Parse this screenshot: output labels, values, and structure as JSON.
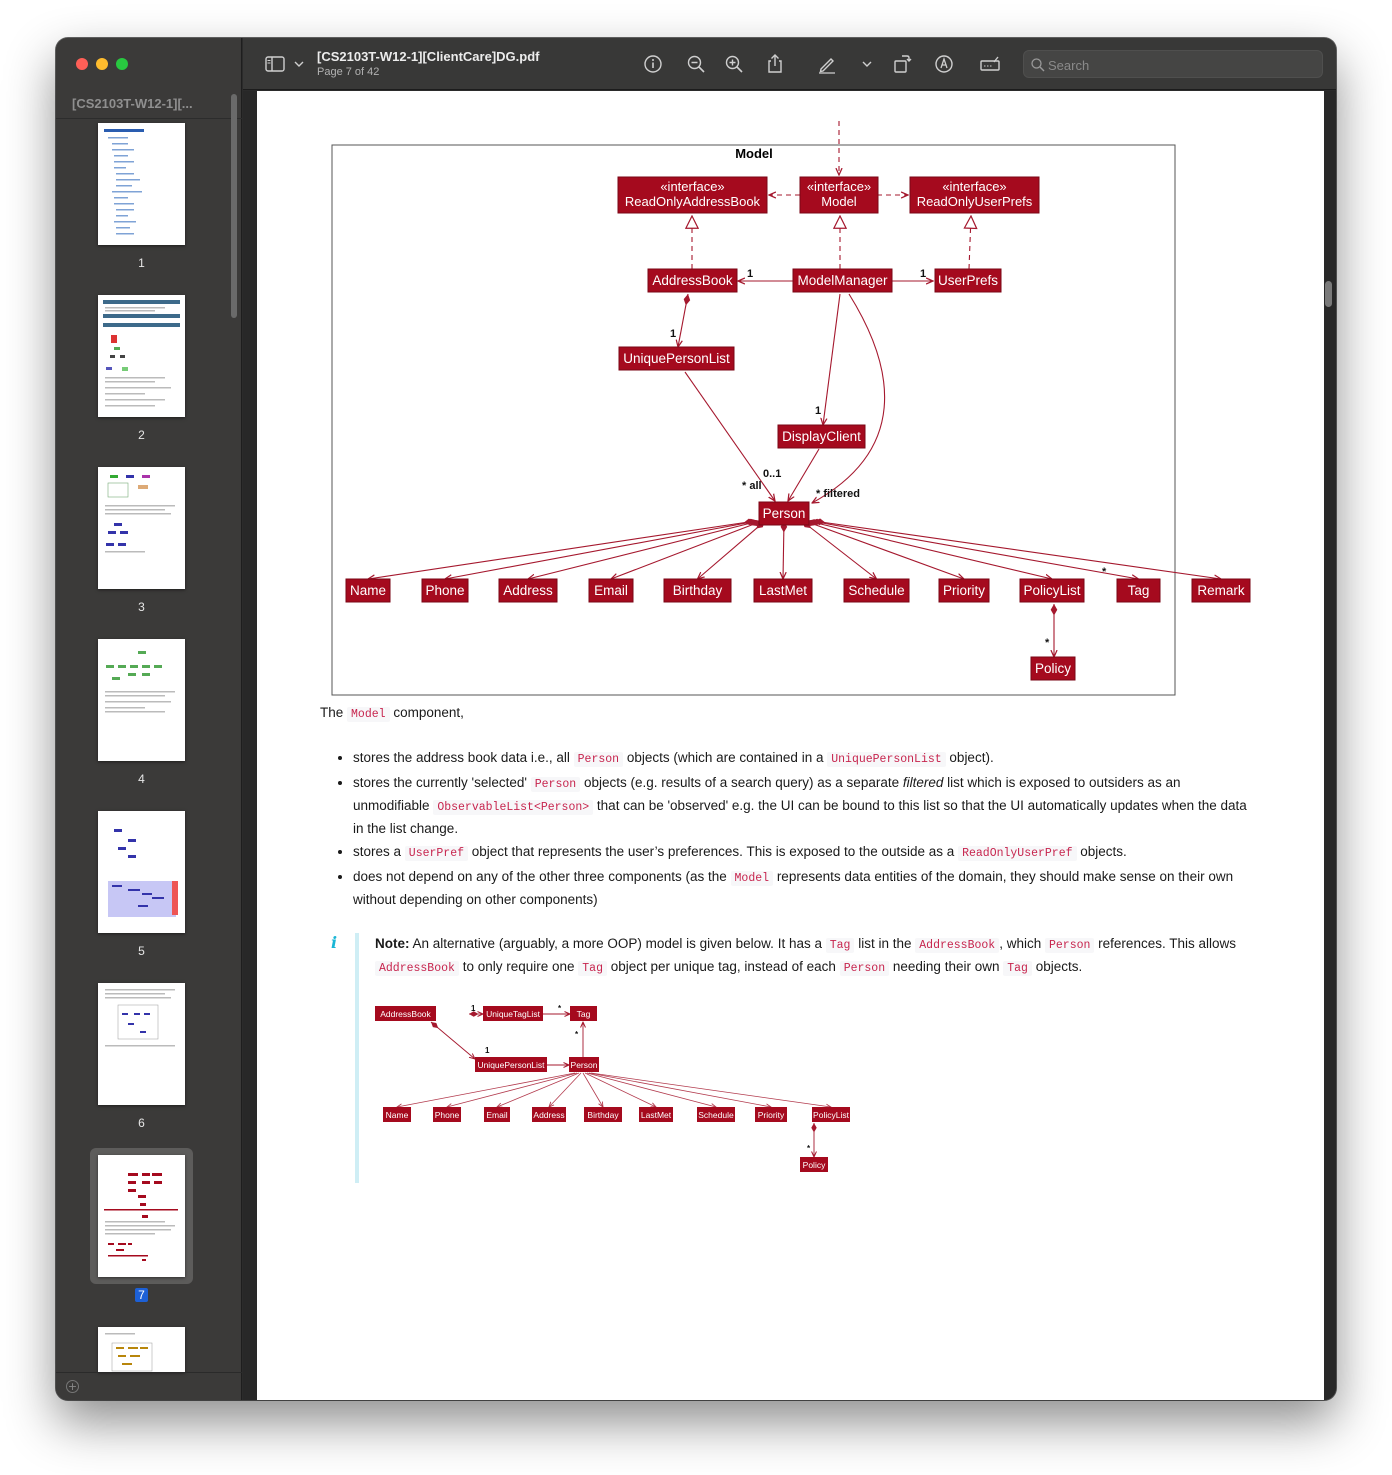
{
  "app": {
    "doc_title": "[CS2103T-W12-1][ClientCare]DG.pdf",
    "page_indicator": "Page 7 of 42",
    "search_placeholder": "Search"
  },
  "sidebar": {
    "title": "[CS2103T-W12-1][...",
    "thumbnails": [
      "1",
      "2",
      "3",
      "4",
      "5",
      "6",
      "7"
    ],
    "selected": "7"
  },
  "colors": {
    "uml_fill": "#a50a1e",
    "uml_line": "#a5182e",
    "code_text": "#c7254e",
    "note_icon": "#19b6d6",
    "selection": "#1d60d6"
  },
  "diagram": {
    "frame_label": "Model",
    "classes": {
      "ro_address_book": [
        "«interface»",
        "ReadOnlyAddressBook"
      ],
      "model": [
        "«interface»",
        "Model"
      ],
      "ro_user_prefs": [
        "«interface»",
        "ReadOnlyUserPrefs"
      ],
      "address_book": "AddressBook",
      "model_manager": "ModelManager",
      "user_prefs": "UserPrefs",
      "unique_person_list": "UniquePersonList",
      "display_client": "DisplayClient",
      "person": "Person",
      "attributes": [
        "Name",
        "Phone",
        "Address",
        "Email",
        "Birthday",
        "LastMet",
        "Schedule",
        "Priority",
        "PolicyList",
        "Tag",
        "Remark"
      ],
      "policy": "Policy"
    },
    "multiplicities": {
      "ab": "1",
      "up": "1",
      "upl": "1",
      "dc": "1",
      "opt": "0..1",
      "all": "* all",
      "filtered": "* filtered",
      "tag": "*",
      "policy": "*"
    }
  },
  "content": {
    "intro": {
      "pre": "The",
      "code": "Model",
      "post": "component,"
    },
    "bullets": [
      {
        "a": "stores the address book data i.e., all",
        "c1": "Person",
        "b": "objects (which are contained in a",
        "c2": "UniquePersonList",
        "d": "object)."
      },
      {
        "a": "stores the currently 'selected'",
        "c1": "Person",
        "b": "objects (e.g. results of a search query) as a separate",
        "em": "filtered",
        "c": "list which is exposed to outsiders as an unmodifiable",
        "c2": "ObservableList<Person>",
        "d": "that can be 'observed' e.g. the UI can be bound to this list so that the UI automatically updates when the data in the list change."
      },
      {
        "a": "stores a",
        "c1": "UserPref",
        "b": "object that represents the user’s preferences. This is exposed to the outside as a",
        "c2": "ReadOnlyUserPref",
        "d": "objects."
      },
      {
        "a": "does not depend on any of the other three components (as the",
        "c1": "Model",
        "b": "represents data entities of the domain, they should make sense on their own without depending on other components)"
      }
    ],
    "note": {
      "icon": "i",
      "label": "Note:",
      "t1": "An alternative (arguably, a more OOP) model is given below. It has a",
      "c1": "Tag",
      "t2": "list in the",
      "c2": "AddressBook",
      "t3": ", which",
      "c3": "Person",
      "t4": "references. This allows",
      "c4": "AddressBook",
      "t5": "to only require one",
      "c5": "Tag",
      "t6": "object per unique tag, instead of each",
      "c6": "Person",
      "t7": "needing their own",
      "c7": "Tag",
      "t8": "objects."
    }
  },
  "small_diagram": {
    "classes": {
      "address_book": "AddressBook",
      "unique_tag_list": "UniqueTagList",
      "tag": "Tag",
      "unique_person_list": "UniquePersonList",
      "person": "Person",
      "attributes": [
        "Name",
        "Phone",
        "Email",
        "Address",
        "Birthday",
        "LastMet",
        "Schedule",
        "Priority",
        "PolicyList"
      ],
      "policy": "Policy"
    },
    "mult": {
      "m1": "1",
      "m2": "*",
      "m3": "1",
      "m4": "*",
      "m5": "*"
    }
  }
}
